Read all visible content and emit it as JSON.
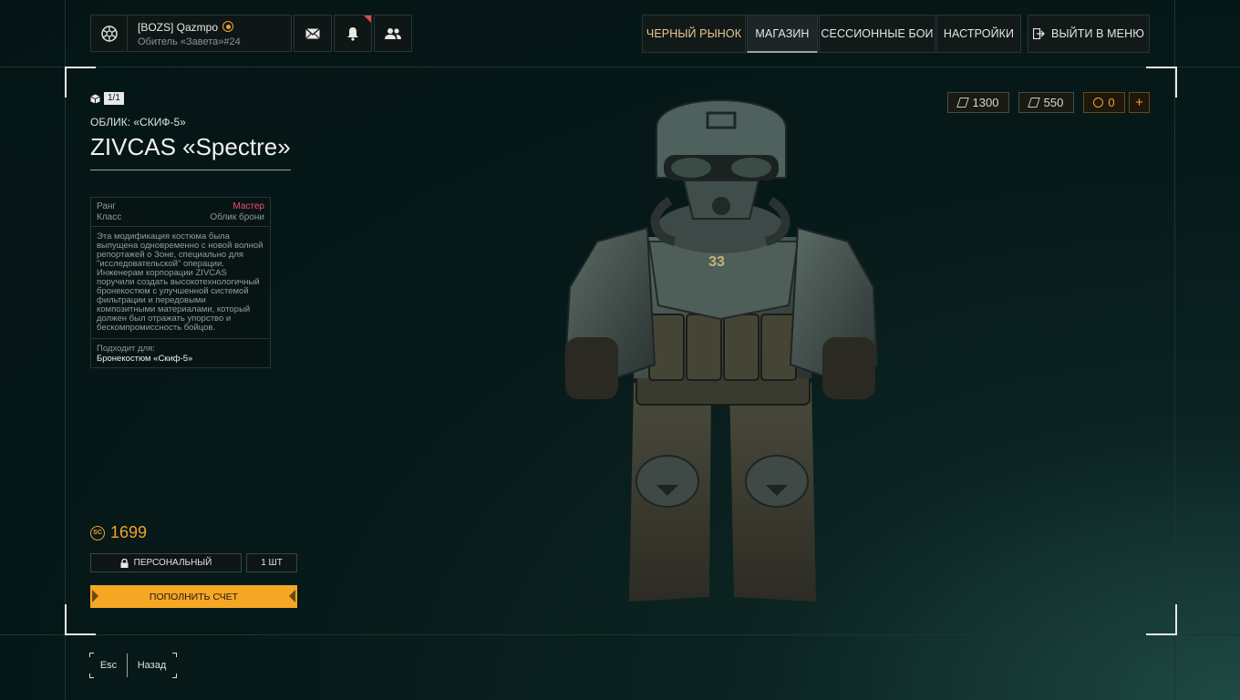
{
  "profile": {
    "name": "[BOZS] Qazmpo",
    "subtitle": "Обитель «Завета»#24"
  },
  "nav": [
    {
      "label": "ЧЕРНЫЙ РЫНОК"
    },
    {
      "label": "МАГАЗИН",
      "active": true
    },
    {
      "label": "СЕССИОННЫЕ БОИ"
    },
    {
      "label": "НАСТРОЙКИ"
    }
  ],
  "exit_label": "ВЫЙТИ В МЕНЮ",
  "item": {
    "count": "1/1",
    "subtitle": "ОБЛИК: «СКИФ-5»",
    "title": "ZIVCAS «Spectre»",
    "rank_label": "Ранг",
    "rank_value": "Мастер",
    "class_label": "Класс",
    "class_value": "Облик брони",
    "description": "Эта модификация костюма была выпущена одновременно с новой волной репортажей о Зоне, специально для \"исследовательской\" операции. Инженерам корпорации ZIVCAS поручили создать высокотехнологичный бронекостюм с улучшенной системой фильтрации и передовыми композитными материалами, который должен был отражать упорство и бескомпромиссность бойцов.",
    "fits_label": "Подходит для:",
    "fits_value": "Бронекостюм «Скиф-5»",
    "price": "1699",
    "price_currency": "SC",
    "personal_label": "ПЕРСОНАЛЬНЫЙ",
    "qty_label": "1 ШТ",
    "topup_label": "ПОПОЛНИТЬ СЧЕТ"
  },
  "currencies": {
    "ticket1": "1300",
    "ticket2": "550",
    "coins": "0",
    "plus": "+"
  },
  "bottom": {
    "key": "Esc",
    "back": "Назад"
  },
  "colors": {
    "accent": "#f5a623",
    "rank": "#f0506e",
    "background": "#061818"
  },
  "icons": [
    "faction-emblem-icon",
    "mail-icon",
    "bell-icon",
    "friends-icon",
    "exit-icon",
    "cube-icon",
    "lock-icon",
    "ticket-icon",
    "coin-icon"
  ]
}
